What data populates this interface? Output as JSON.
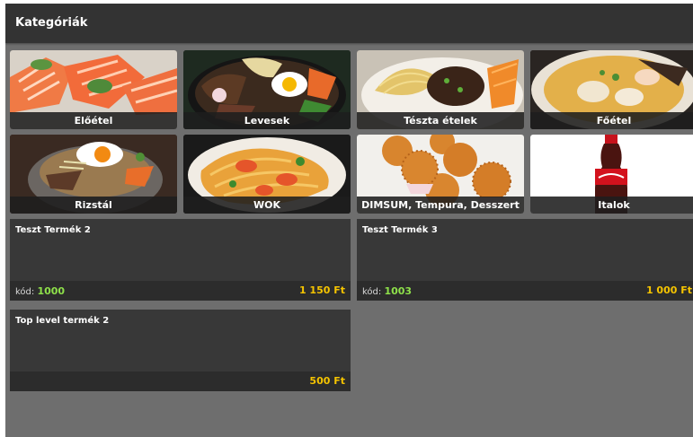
{
  "header": {
    "title": "Kategóriák"
  },
  "categories": [
    {
      "label": "Előétel",
      "image": "salmon-sashimi-image"
    },
    {
      "label": "Levesek",
      "image": "bibimbap-bowl-image"
    },
    {
      "label": "Tészta ételek",
      "image": "noodle-plate-image"
    },
    {
      "label": "Főétel",
      "image": "curry-plate-image"
    },
    {
      "label": "Rizstál",
      "image": "stone-pot-rice-image"
    },
    {
      "label": "WOK",
      "image": "wok-noodles-image"
    },
    {
      "label": "DIMSUM, Tempura, Desszert",
      "image": "fried-balls-image"
    },
    {
      "label": "Italok",
      "image": "cola-bottle-image"
    }
  ],
  "products": [
    {
      "name": "Teszt Termék 2",
      "code_label": "kód:",
      "code": "1000",
      "price": "1 150 Ft"
    },
    {
      "name": "Teszt Termék 3",
      "code_label": "kód:",
      "code": "1003",
      "price": "1 000 Ft"
    },
    {
      "name": "Top level termék 2",
      "code_label": "",
      "code": "",
      "price": "500 Ft"
    }
  ],
  "colors": {
    "background": "#6e6e6e",
    "header": "#333333",
    "card": "#383838",
    "code": "#8ee04a",
    "price": "#f5c400"
  }
}
